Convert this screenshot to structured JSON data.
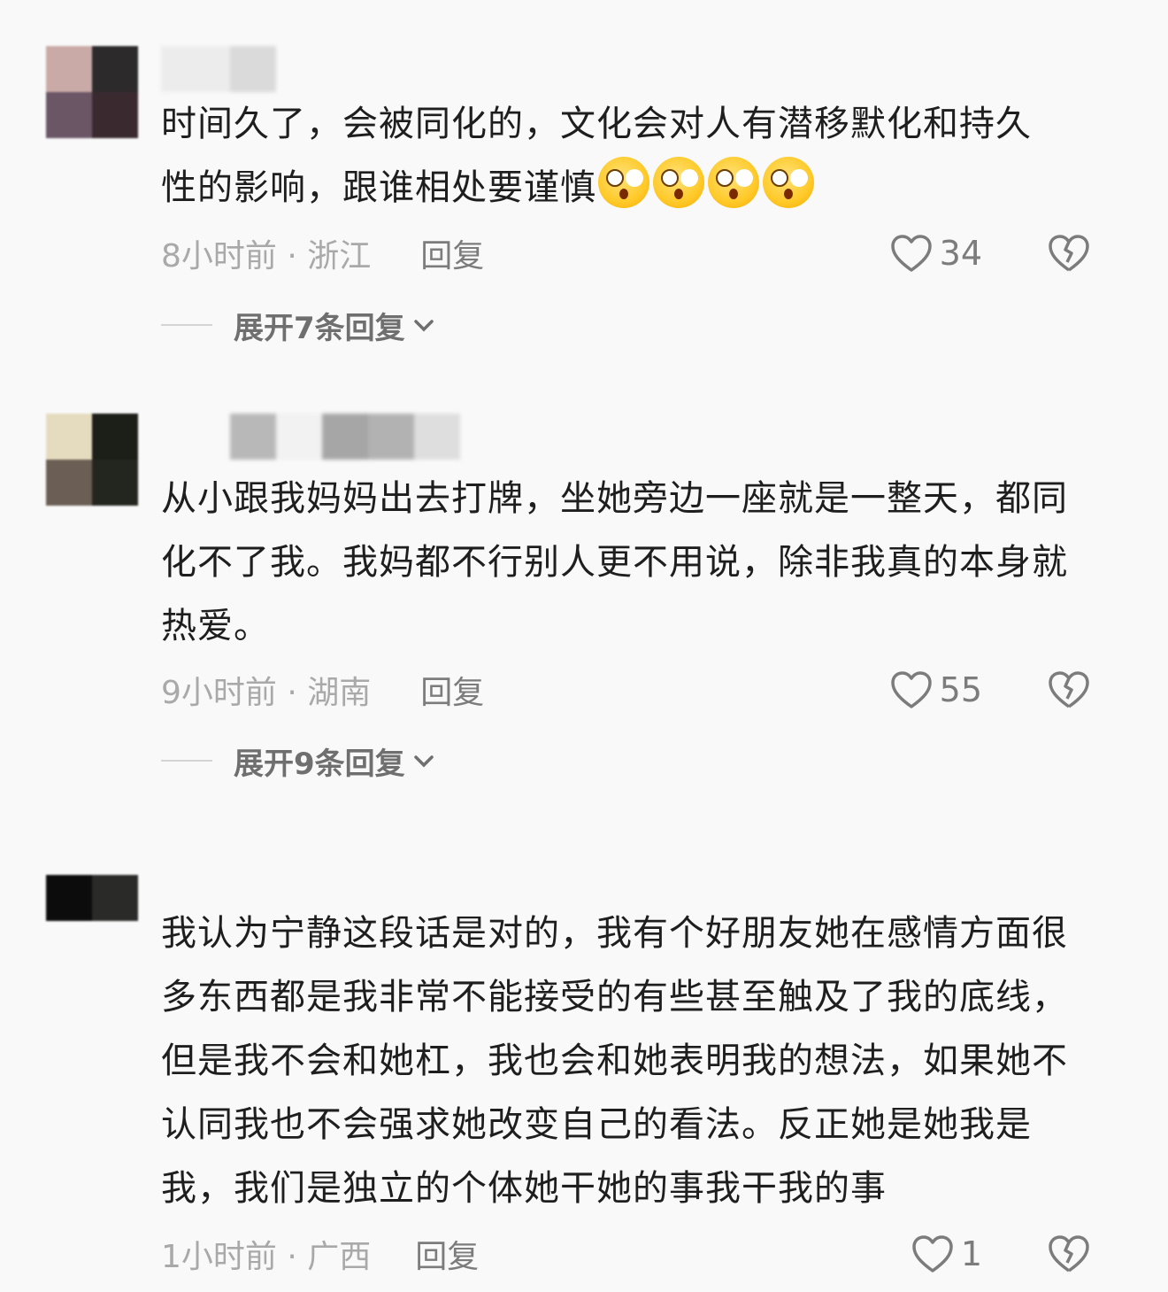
{
  "comments": [
    {
      "text_line1": "时间久了，会被同化的，文化会对人有潜移默化和持久",
      "text_line2": "性的影响，跟谁相处要谨慎",
      "emoji_name": "crying-face-emoji",
      "time_location": "8小时前 · 浙江",
      "reply_label": "回复",
      "like_count": "34",
      "expand_label": "展开7条回复"
    },
    {
      "text": "从小跟我妈妈出去打牌，坐她旁边一座就是一整天，都同化不了我。我妈都不行别人更不用说，除非我真的本身就热爱。",
      "time_location": "9小时前 · 湖南",
      "reply_label": "回复",
      "like_count": "55",
      "expand_label": "展开9条回复"
    },
    {
      "text": "我认为宁静这段话是对的，我有个好朋友她在感情方面很多东西都是我非常不能接受的有些甚至触及了我的底线，但是我不会和她杠，我也会和她表明我的想法，如果她不认同我也不会强求她改变自己的看法。反正她是她我是我，我们是独立的个体她干她的事我干我的事",
      "time_location": "1小时前 · 广西",
      "reply_label": "回复",
      "like_count": "1"
    }
  ],
  "icons": {
    "like": "heart-outline-icon",
    "dislike": "broken-heart-icon",
    "expand": "chevron-down-icon"
  },
  "colors": {
    "background": "#f9f9f9",
    "text": "#1e1e1e",
    "meta": "#a9a9a9",
    "secondary": "#7c7c7c"
  }
}
